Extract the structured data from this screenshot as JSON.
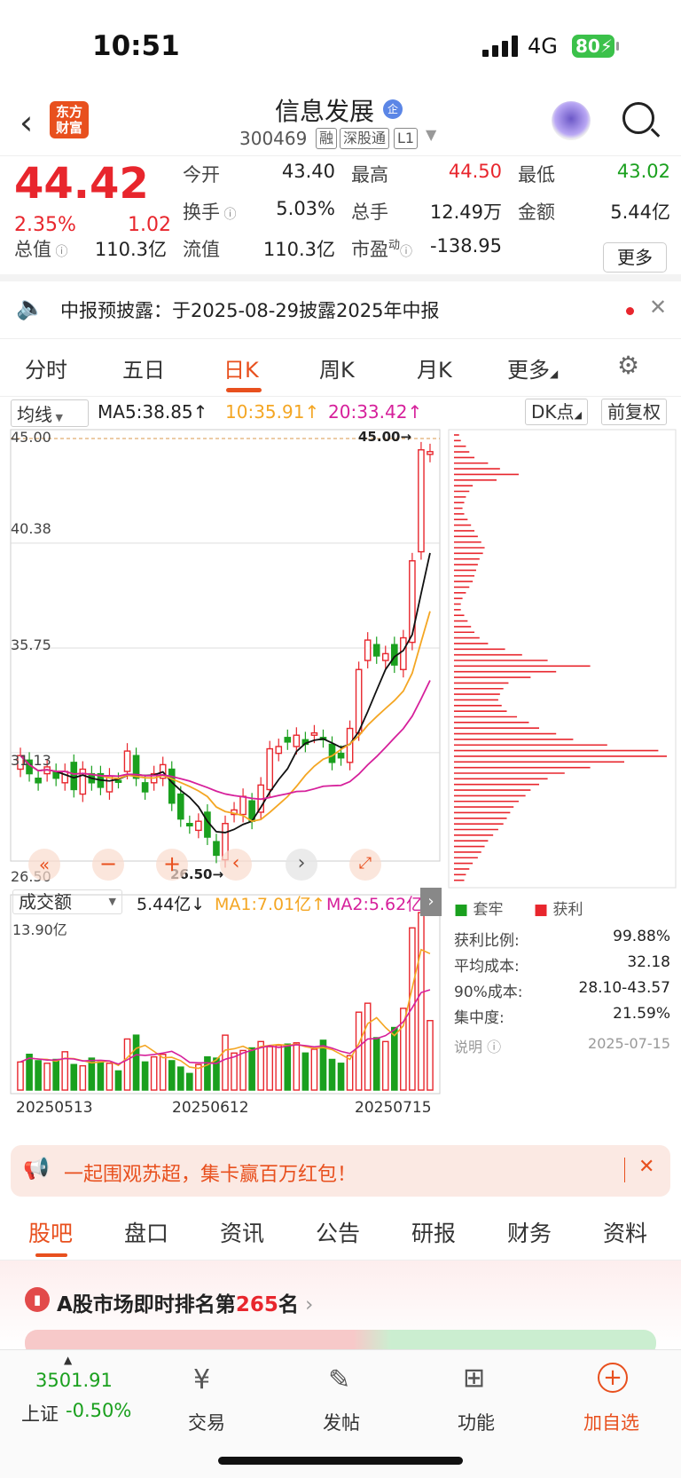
{
  "status": {
    "time": "10:51",
    "network": "4G",
    "battery": "80"
  },
  "header": {
    "name": "信息发展",
    "badge": "企",
    "code": "300469",
    "tags": [
      "融",
      "深股通",
      "L1"
    ]
  },
  "quote": {
    "price": "44.42",
    "pct": "2.35%",
    "change": "1.02",
    "open_label": "今开",
    "open": "43.40",
    "high_label": "最高",
    "high": "44.50",
    "low_label": "最低",
    "low": "43.02",
    "turnover_label": "换手",
    "turnover": "5.03%",
    "vol_label": "总手",
    "vol": "12.49万",
    "amount_label": "金额",
    "amount": "5.44亿",
    "mcap_label": "总值",
    "mcap": "110.3亿",
    "float_label": "流值",
    "float": "110.3亿",
    "pe_label": "市盈",
    "pe_sup": "动",
    "pe": "-138.95",
    "more": "更多"
  },
  "notice": {
    "text": "中报预披露：于2025-08-29披露2025年中报"
  },
  "periods": [
    "分时",
    "五日",
    "日K",
    "周K",
    "月K",
    "更多"
  ],
  "ma": {
    "type": "均线",
    "ma5": "MA5:38.85↑",
    "ma10": "10:35.91↑",
    "ma20": "20:33.42↑",
    "dk": "DK点",
    "fq": "前复权"
  },
  "chart": {
    "yticks": [
      "45.00",
      "40.38",
      "35.75",
      "31.13",
      "26.50"
    ],
    "hi_label": "45.00→",
    "lo_label": "26.50→",
    "vol_sel": "成交额",
    "vol_val": "5.44亿↓",
    "vol_ma1": "MA1:7.01亿↑",
    "vol_ma2": "MA2:5.62亿",
    "vol_max": "13.90亿",
    "dates": [
      "20250513",
      "20250612",
      "20250715"
    ]
  },
  "chart_data": {
    "type": "candlestick",
    "ylim": [
      26.5,
      45.0
    ],
    "closes": [
      31.0,
      30.2,
      29.8,
      30.5,
      30.0,
      30.3,
      29.5,
      30.4,
      29.8,
      29.6,
      30.1,
      29.9,
      31.2,
      30.0,
      29.4,
      30.2,
      30.6,
      28.9,
      28.2,
      27.9,
      28.1,
      27.4,
      26.6,
      28.0,
      28.6,
      29.2,
      28.1,
      29.7,
      31.3,
      31.4,
      31.6,
      31.9,
      31.5,
      32.0,
      31.7,
      30.7,
      30.9,
      32.2,
      34.8,
      36.1,
      35.4,
      35.5,
      35.0,
      36.2,
      39.6,
      44.5,
      44.42
    ],
    "volumes": [
      2.2,
      2.8,
      2.3,
      2.1,
      2.4,
      3.0,
      2.0,
      1.9,
      2.5,
      2.2,
      2.1,
      1.5,
      4.0,
      4.3,
      2.2,
      2.6,
      2.8,
      2.3,
      1.8,
      1.3,
      2.0,
      2.6,
      2.5,
      4.3,
      2.9,
      3.1,
      3.3,
      3.8,
      3.4,
      3.5,
      3.6,
      3.7,
      2.9,
      3.2,
      3.9,
      2.4,
      2.1,
      2.7,
      6.1,
      6.8,
      4.1,
      3.8,
      4.9,
      6.4,
      12.7,
      13.9,
      5.44
    ]
  },
  "dist": {
    "legend_lock": "套牢",
    "legend_profit": "获利",
    "rows": [
      [
        "获利比例:",
        "99.88%"
      ],
      [
        "平均成本:",
        "32.18"
      ],
      [
        "90%成本:",
        "28.10-43.57"
      ],
      [
        "集中度:",
        "21.59%"
      ]
    ],
    "note": "说明",
    "date": "2025-07-15"
  },
  "banner": {
    "text": "一起围观苏超，集卡赢百万红包！"
  },
  "tabs": [
    "股吧",
    "盘口",
    "资讯",
    "公告",
    "研报",
    "财务",
    "资料"
  ],
  "rank": {
    "text1": "A股市场即时排名第",
    "num": "265",
    "text2": "名"
  },
  "bottom": {
    "index": "3501.91",
    "index_label": "上证",
    "index_pct": "-0.50%",
    "items": [
      "交易",
      "发帖",
      "功能",
      "加自选"
    ]
  },
  "colors": {
    "up": "#e8262d",
    "down": "#1aa01e",
    "accent": "#e8501e"
  }
}
